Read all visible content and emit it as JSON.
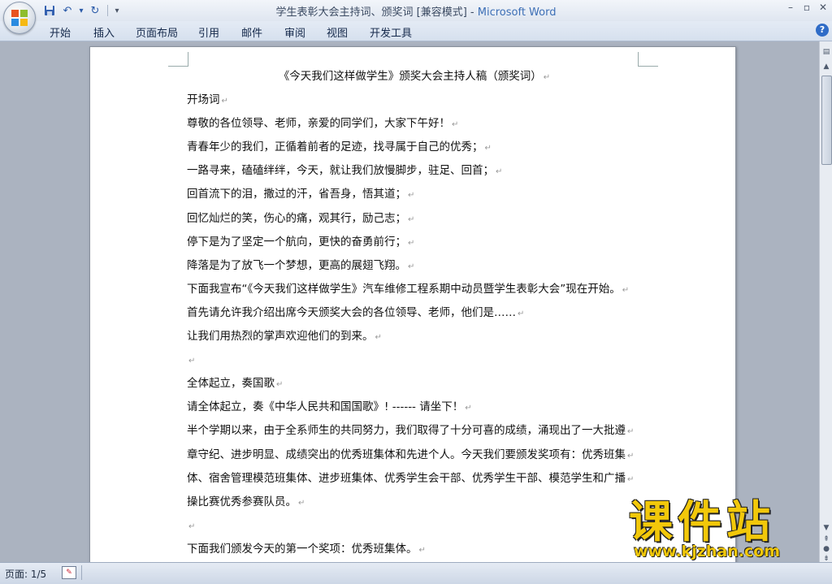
{
  "window": {
    "title_doc": "学生表彰大会主持词、颁奖词 [兼容模式]",
    "title_sep": " - ",
    "title_app": "Microsoft Word",
    "min": "–",
    "restore": "▫",
    "close": "✕"
  },
  "qat": {
    "save": "💾",
    "undo": "↶",
    "dropdown": "▾",
    "redo": "↻",
    "more": "▾"
  },
  "tabs": [
    "开始",
    "插入",
    "页面布局",
    "引用",
    "邮件",
    "审阅",
    "视图",
    "开发工具"
  ],
  "help": "?",
  "document": {
    "title": "《今天我们这样做学生》颁奖大会主持人稿（颁奖词）",
    "paragraph_mark": "↵",
    "lines": [
      "开场词",
      "尊敬的各位领导、老师，亲爱的同学们，大家下午好！",
      "青春年少的我们，正循着前者的足迹，找寻属于自己的优秀；",
      "一路寻来，磕磕绊绊，今天，就让我们放慢脚步，驻足、回首；",
      "回首流下的泪，撒过的汗，省吾身，悟其道；",
      "回忆灿烂的笑，伤心的痛，观其行，励己志；",
      "停下是为了坚定一个航向，更快的奋勇前行；",
      "降落是为了放飞一个梦想，更高的展翅飞翔。",
      "下面我宣布“《今天我们这样做学生》汽车维修工程系期中动员暨学生表彰大会”现在开始。",
      "首先请允许我介绍出席今天颁奖大会的各位领导、老师，他们是……",
      "让我们用热烈的掌声欢迎他们的到来。",
      "",
      "全体起立，奏国歌",
      "请全体起立，奏《中华人民共和国国歌》! ------ 请坐下！",
      "半个学期以来，由于全系师生的共同努力，我们取得了十分可喜的成绩，涌现出了一大批遵",
      "章守纪、进步明显、成绩突出的优秀班集体和先进个人。今天我们要颁发奖项有：优秀班集",
      "体、宿舍管理模范班集体、进步班集体、优秀学生会干部、优秀学生干部、模范学生和广播",
      "操比赛优秀参赛队员。",
      "",
      "下面我们颁发今天的第一个奖项：优秀班集体。"
    ]
  },
  "watermark": {
    "cn": "课件站",
    "url": "www.kjzhan.com"
  },
  "status": {
    "page": "页面: 1/5"
  }
}
